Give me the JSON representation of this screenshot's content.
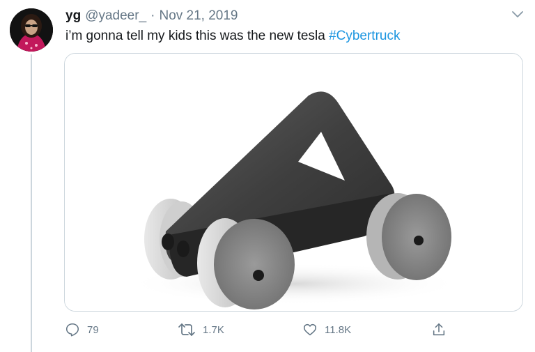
{
  "tweet": {
    "display_name": "yg",
    "handle": "@yadeer_",
    "separator": "·",
    "date": "Nov 21, 2019",
    "text": "i’m gonna tell my kids this was the new tesla",
    "hashtag": "#Cybertruck",
    "media_icon": "toy-truck-photo"
  },
  "actions": {
    "reply_count": "79",
    "retweet_count": "1.7K",
    "like_count": "11.8K",
    "reply_icon": "reply-icon",
    "retweet_icon": "retweet-icon",
    "like_icon": "heart-icon",
    "share_icon": "share-icon"
  },
  "colors": {
    "link": "#1b95e0",
    "secondary_text": "#657786",
    "border": "#ccd6dd"
  }
}
